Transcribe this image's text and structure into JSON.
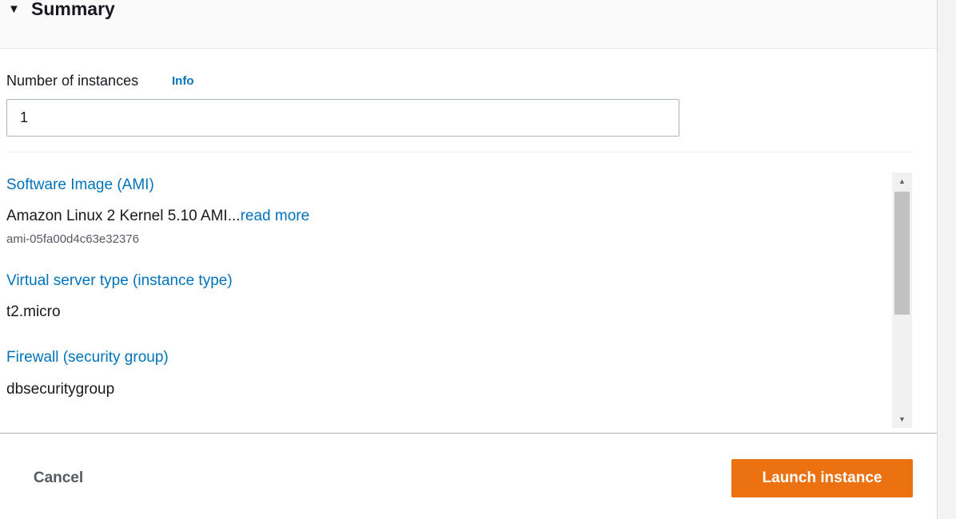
{
  "summary": {
    "caret_icon": "caret-down-icon",
    "title": "Summary"
  },
  "instances": {
    "label": "Number of instances",
    "info_link": "Info",
    "value": "1"
  },
  "details": {
    "ami": {
      "heading": "Software Image (AMI)",
      "value": "Amazon Linux 2 Kernel 5.10 AMI...",
      "read_more": "read more",
      "id": "ami-05fa00d4c63e32376"
    },
    "instance_type": {
      "heading": "Virtual server type (instance type)",
      "value": "t2.micro"
    },
    "firewall": {
      "heading": "Firewall (security group)",
      "value": "dbsecuritygroup"
    }
  },
  "scrollbar": {
    "up_icon": "arrow-up-icon",
    "down_icon": "arrow-down-icon"
  },
  "footer": {
    "cancel_label": "Cancel",
    "launch_label": "Launch instance"
  },
  "colors": {
    "link": "#0073bb",
    "primary_button": "#ec7211",
    "text": "#16191f",
    "secondary_text": "#545b64"
  }
}
